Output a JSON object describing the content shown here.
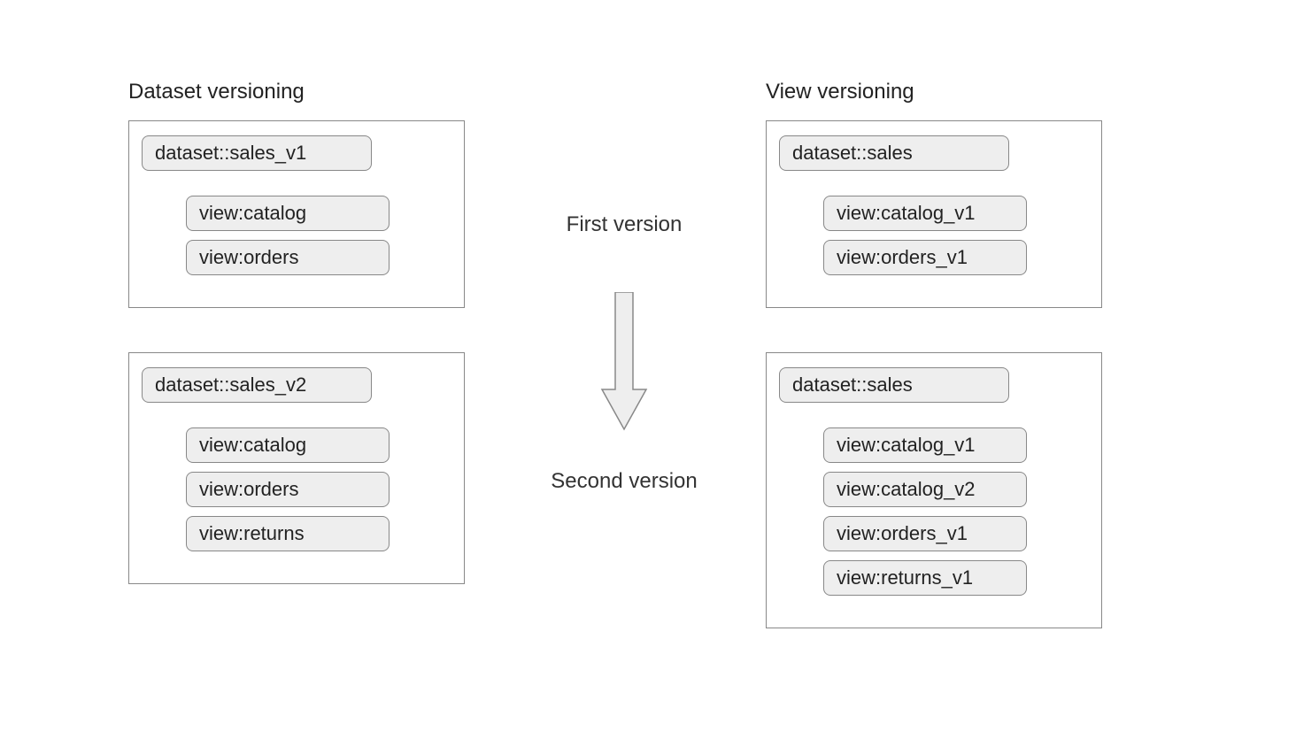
{
  "left": {
    "heading": "Dataset versioning",
    "panels": [
      {
        "dataset": "dataset::sales_v1",
        "views": [
          "view:catalog",
          "view:orders"
        ]
      },
      {
        "dataset": "dataset::sales_v2",
        "views": [
          "view:catalog",
          "view:orders",
          "view:returns"
        ]
      }
    ]
  },
  "right": {
    "heading": "View versioning",
    "panels": [
      {
        "dataset": "dataset::sales",
        "views": [
          "view:catalog_v1",
          "view:orders_v1"
        ]
      },
      {
        "dataset": "dataset::sales",
        "views": [
          "view:catalog_v1",
          "view:catalog_v2",
          "view:orders_v1",
          "view:returns_v1"
        ]
      }
    ]
  },
  "center": {
    "first": "First version",
    "second": "Second version"
  }
}
